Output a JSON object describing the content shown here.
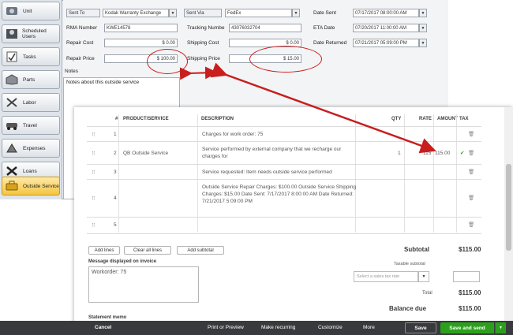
{
  "sidebar": {
    "items": [
      {
        "label": "Unit",
        "icon": "unit-icon"
      },
      {
        "label": "Scheduled Users",
        "icon": "users-icon"
      },
      {
        "label": "Tasks",
        "icon": "tasks-icon"
      },
      {
        "label": "Parts",
        "icon": "parts-icon"
      },
      {
        "label": "Labor",
        "icon": "labor-icon"
      },
      {
        "label": "Travel",
        "icon": "travel-icon"
      },
      {
        "label": "Expenses",
        "icon": "expenses-icon"
      },
      {
        "label": "Loans",
        "icon": "loans-icon"
      },
      {
        "label": "Outside Service",
        "icon": "outside-service-icon"
      }
    ]
  },
  "form": {
    "sent_to_label": "Sent To",
    "sent_to_value": "Kodak Warranty Exchange",
    "sent_via_label": "Sent Via",
    "sent_via_value": "FedEx",
    "date_sent_label": "Date Sent",
    "date_sent_value": "07/17/2017 08:00:00 AM",
    "rma_label": "RMA Number",
    "rma_value": "KWE14578",
    "tracking_label": "Tracking Numbe",
    "tracking_value": "43076032704",
    "eta_label": "ETA Date",
    "eta_value": "07/20/2017 11:00:00 AM",
    "repair_cost_label": "Repair Cost",
    "repair_cost_value": "$ 0.00",
    "shipping_cost_label": "Shipping Cost",
    "shipping_cost_value": "$ 0.00",
    "date_returned_label": "Date Returned",
    "date_returned_value": "07/21/2017 05:09:00 PM",
    "repair_price_label": "Repair Price",
    "repair_price_value": "$ 100.00",
    "shipping_price_label": "Shipping Price",
    "shipping_price_value": "$ 15.00",
    "notes_label": "Notes",
    "notes_value": "Notes about this outside service"
  },
  "invoice": {
    "headers": {
      "num": "#",
      "product": "PRODUCT/SERVICE",
      "description": "DESCRIPTION",
      "qty": "QTY",
      "rate": "RATE",
      "amount": "AMOUNT",
      "tax": "TAX"
    },
    "rows": [
      {
        "num": "1",
        "product": "",
        "description": "Charges for work order: 75",
        "qty": "",
        "rate": "",
        "amount": "",
        "tax": ""
      },
      {
        "num": "2",
        "product": "QB Outside Service",
        "description": "Service performed by external company that we recharge our charges for",
        "qty": "1",
        "rate": "115",
        "amount": "115.00",
        "tax": "✔"
      },
      {
        "num": "3",
        "product": "",
        "description": "Service requested: Item needs outside service performed",
        "qty": "",
        "rate": "",
        "amount": "",
        "tax": ""
      },
      {
        "num": "4",
        "product": "",
        "description": "Outside Service Repair Charges: $100.00  Outside Service Shipping Charges: $15.00 Date Sent: 7/17/2017 8:00:00 AM  Date Returned: 7/21/2017 5:09:00 PM",
        "qty": "",
        "rate": "",
        "amount": "",
        "tax": ""
      },
      {
        "num": "5",
        "product": "",
        "description": "",
        "qty": "",
        "rate": "",
        "amount": "",
        "tax": ""
      }
    ],
    "add_lines": "Add lines",
    "clear_all_lines": "Clear all lines",
    "add_subtotal": "Add subtotal",
    "message_label": "Message displayed on invoice",
    "message_value": "Workorder: 75",
    "subtotal_label": "Subtotal",
    "subtotal_value": "$115.00",
    "taxable_subtotal_label": "Taxable subtotal",
    "tax_rate_placeholder": "Select a sales tax rate",
    "total_label": "Total",
    "total_value": "$115.00",
    "balance_due_label": "Balance due",
    "balance_due_value": "$115.00",
    "statement_memo_label": "Statement memo"
  },
  "footer": {
    "cancel": "Cancel",
    "print_preview": "Print or Preview",
    "make_recurring": "Make recurring",
    "customize": "Customize",
    "more": "More",
    "save": "Save",
    "save_and_send": "Save and send"
  },
  "colors": {
    "annotation": "#c81e1e",
    "save_send": "#2ca01c",
    "footer_bg": "#393a3d",
    "active_tab": "#f4c542"
  }
}
